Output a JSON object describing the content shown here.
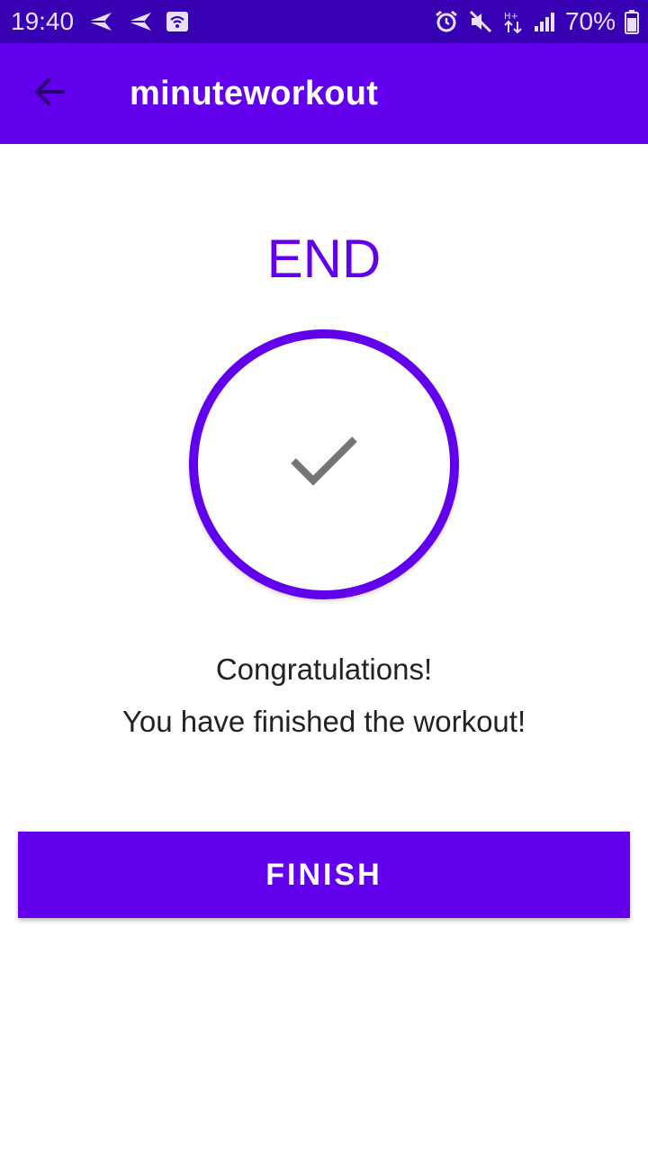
{
  "status_bar": {
    "time": "19:40",
    "battery": "70%",
    "left_icons": [
      "send-icon",
      "send-icon",
      "wifi-box-icon"
    ],
    "right_icons": [
      "alarm-icon",
      "mute-icon",
      "data-transfer-icon",
      "signal-icon",
      "battery-icon"
    ]
  },
  "app_bar": {
    "title": "minuteworkout",
    "back_icon": "arrow-back-icon"
  },
  "main": {
    "heading": "END",
    "check_icon": "check-icon",
    "message_line1": "Congratulations!",
    "message_line2": "You have finished the workout!",
    "finish_label": "FINISH"
  },
  "colors": {
    "primary": "#6200ee",
    "primary_dark": "#3700b3",
    "text": "#222222",
    "check": "#757575"
  }
}
